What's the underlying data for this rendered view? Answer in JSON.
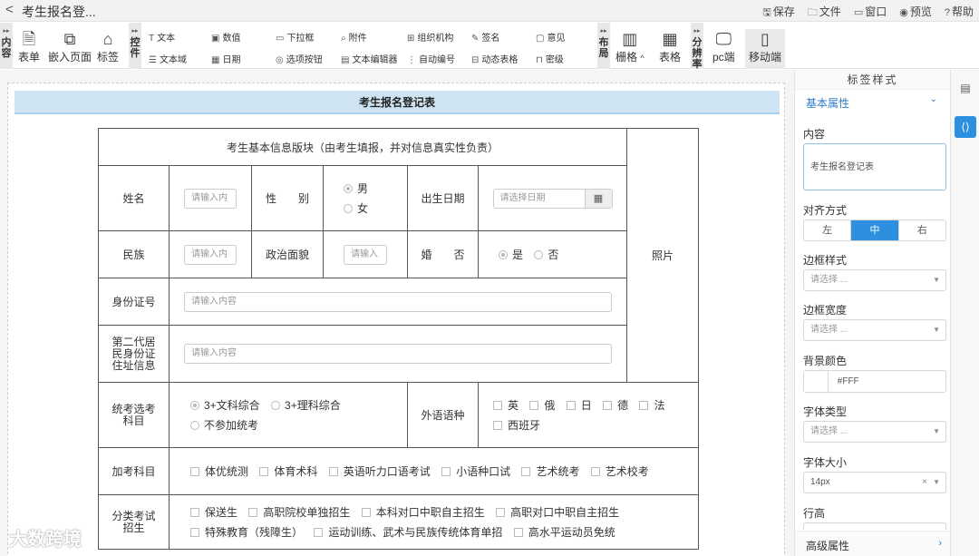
{
  "topbar": {
    "back_icon": "<",
    "title": "考生报名登...",
    "actions": [
      {
        "icon": "save-icon",
        "glyph": "🖫",
        "label": "保存"
      },
      {
        "icon": "folder-icon",
        "glyph": "🗀",
        "label": "文件"
      },
      {
        "icon": "window-icon",
        "glyph": "▭",
        "label": "窗口"
      },
      {
        "icon": "eye-icon",
        "glyph": "◉",
        "label": "预览"
      },
      {
        "icon": "help-icon",
        "glyph": "?",
        "label": "帮助"
      }
    ]
  },
  "toolbar": {
    "tab_content": "内容",
    "tab_controls": "控件",
    "tab_layout": "布局",
    "tab_resolution": "分辨率",
    "btn_form": "表单",
    "btn_embed": "嵌入页面",
    "btn_tag": "标签",
    "ctl_text": "文本",
    "ctl_textarea": "文本域",
    "ctl_number": "数值",
    "ctl_date": "日期",
    "ctl_dropdown": "下拉框",
    "ctl_option": "选项按钮",
    "ctl_attach": "附件",
    "ctl_editor": "文本编辑器",
    "ctl_org": "组织机构",
    "ctl_autonum": "自动编号",
    "ctl_sign": "签名",
    "ctl_dyntable": "动态表格",
    "ctl_opinion": "意见",
    "ctl_secret": "密级",
    "btn_grid": "栅格",
    "btn_table": "表格",
    "btn_pc": "pc端",
    "btn_mobile": "移动端"
  },
  "form": {
    "banner": "考生报名登记表",
    "section_header": "考生基本信息版块（由考生填报，并对信息真实性负责）",
    "photo": "照片",
    "name_label": "姓名",
    "name_placeholder": "请输入内",
    "gender_label": "性　　别",
    "gender_male": "男",
    "gender_female": "女",
    "birth_label": "出生日期",
    "birth_placeholder": "请选择日期",
    "ethnic_label": "民族",
    "ethnic_placeholder": "请输入内",
    "political_label": "政治面貌",
    "political_placeholder": "请输入",
    "marital_label": "婚　　否",
    "marital_yes": "是",
    "marital_no": "否",
    "id_label": "身份证号",
    "id_placeholder": "请输入内容",
    "address_label": "第二代居民身份证住址信息",
    "address_placeholder": "请输入内容",
    "exam_label": "统考选考科目",
    "exam_opt1": "3+文科综合",
    "exam_opt2": "3+理科综合",
    "exam_opt3": "不参加统考",
    "lang_label": "外语语种",
    "lang_options": [
      "英",
      "俄",
      "日",
      "德",
      "法",
      "西班牙"
    ],
    "extra_label": "加考科目",
    "extra_options": [
      "体优统测",
      "体育术科",
      "英语听力口语考试",
      "小语种口试",
      "艺术统考",
      "艺术校考"
    ],
    "category_label": "分类考试招生",
    "category_row1": [
      "保送生",
      "高职院校单独招生",
      "本科对口中职自主招生",
      "高职对口中职自主招生"
    ],
    "category_row2": [
      "特殊教育（残障生）",
      "运动训练、武术与民族传统体育单招",
      "高水平运动员免统"
    ]
  },
  "panel": {
    "title": "标签样式",
    "section": "基本属性",
    "content_label": "内容",
    "content_value": "考生报名登记表",
    "align_label": "对齐方式",
    "align_options": [
      "左",
      "中",
      "右"
    ],
    "align_selected": "中",
    "border_style_label": "边框样式",
    "border_style_placeholder": "请选择 ...",
    "border_width_label": "边框宽度",
    "border_width_placeholder": "请选择 ...",
    "bg_label": "背景颜色",
    "bg_value": "#FFF",
    "font_type_label": "字体类型",
    "font_type_placeholder": "请选择 ...",
    "font_size_label": "字体大小",
    "font_size_value": "14px",
    "line_height_label": "行高",
    "advanced": "高级属性"
  },
  "watermark": "大数跨境",
  "colors": {
    "accent": "#2d8fe0",
    "banner": "#cfe4f3"
  }
}
